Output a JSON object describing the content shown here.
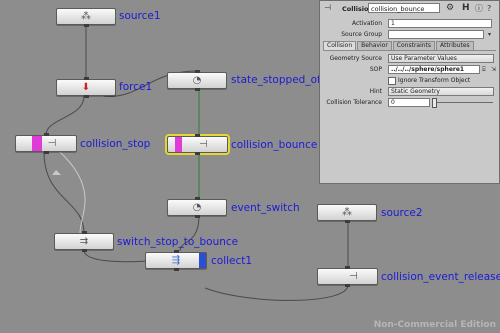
{
  "app": {
    "watermark": "Non-Commercial Edition"
  },
  "colors": {
    "background": "#8d8d8d",
    "label": "#1b1bd8",
    "selected_outline": "#e5d633",
    "flag_magenta": "#e03ad9",
    "flag_blue": "#2a4fd0",
    "flag_yellow": "#e5d633"
  },
  "network": {
    "nodes": [
      {
        "id": "source1",
        "label": "source1",
        "icon": "scatter-points-icon"
      },
      {
        "id": "force1",
        "label": "force1",
        "icon": "force-arrow-icon"
      },
      {
        "id": "state_stopped_off",
        "label": "state_stopped_off",
        "icon": "state-clock-icon"
      },
      {
        "id": "collision_stop",
        "label": "collision_stop",
        "icon": "collision-icon"
      },
      {
        "id": "collision_bounce",
        "label": "collision_bounce",
        "icon": "collision-icon"
      },
      {
        "id": "event_switch",
        "label": "event_switch",
        "icon": "state-clock-icon"
      },
      {
        "id": "source2",
        "label": "source2",
        "icon": "scatter-points-icon"
      },
      {
        "id": "switch_stop_to_bounce",
        "label": "switch_stop_to_bounce",
        "icon": "switch-icon"
      },
      {
        "id": "collision_event_release",
        "label": "collision_event_release",
        "icon": "collision-icon"
      },
      {
        "id": "collect1",
        "label": "collect1",
        "icon": "collect-arrows-icon"
      }
    ]
  },
  "panel": {
    "type_label": "Collision",
    "node_name": "collision_bounce",
    "header_icons": [
      "gear-icon",
      "help-h-icon",
      "info-icon",
      "question-icon"
    ],
    "activation": {
      "label": "Activation",
      "value": "1"
    },
    "source_group": {
      "label": "Source Group",
      "value": ""
    },
    "tabs": [
      "Collision",
      "Behavior",
      "Constraints",
      "Attributes"
    ],
    "geometry_source": {
      "label": "Geometry Source",
      "value": "Use Parameter Values"
    },
    "sop": {
      "label": "SOP",
      "value": "../../../sphere/sphere1"
    },
    "ignore_transform": {
      "label": "Ignore Transform Object",
      "checked": false
    },
    "hint": {
      "label": "Hint",
      "value": "Static Geometry"
    },
    "tolerance": {
      "label": "Collision Tolerance",
      "value": "0"
    }
  }
}
